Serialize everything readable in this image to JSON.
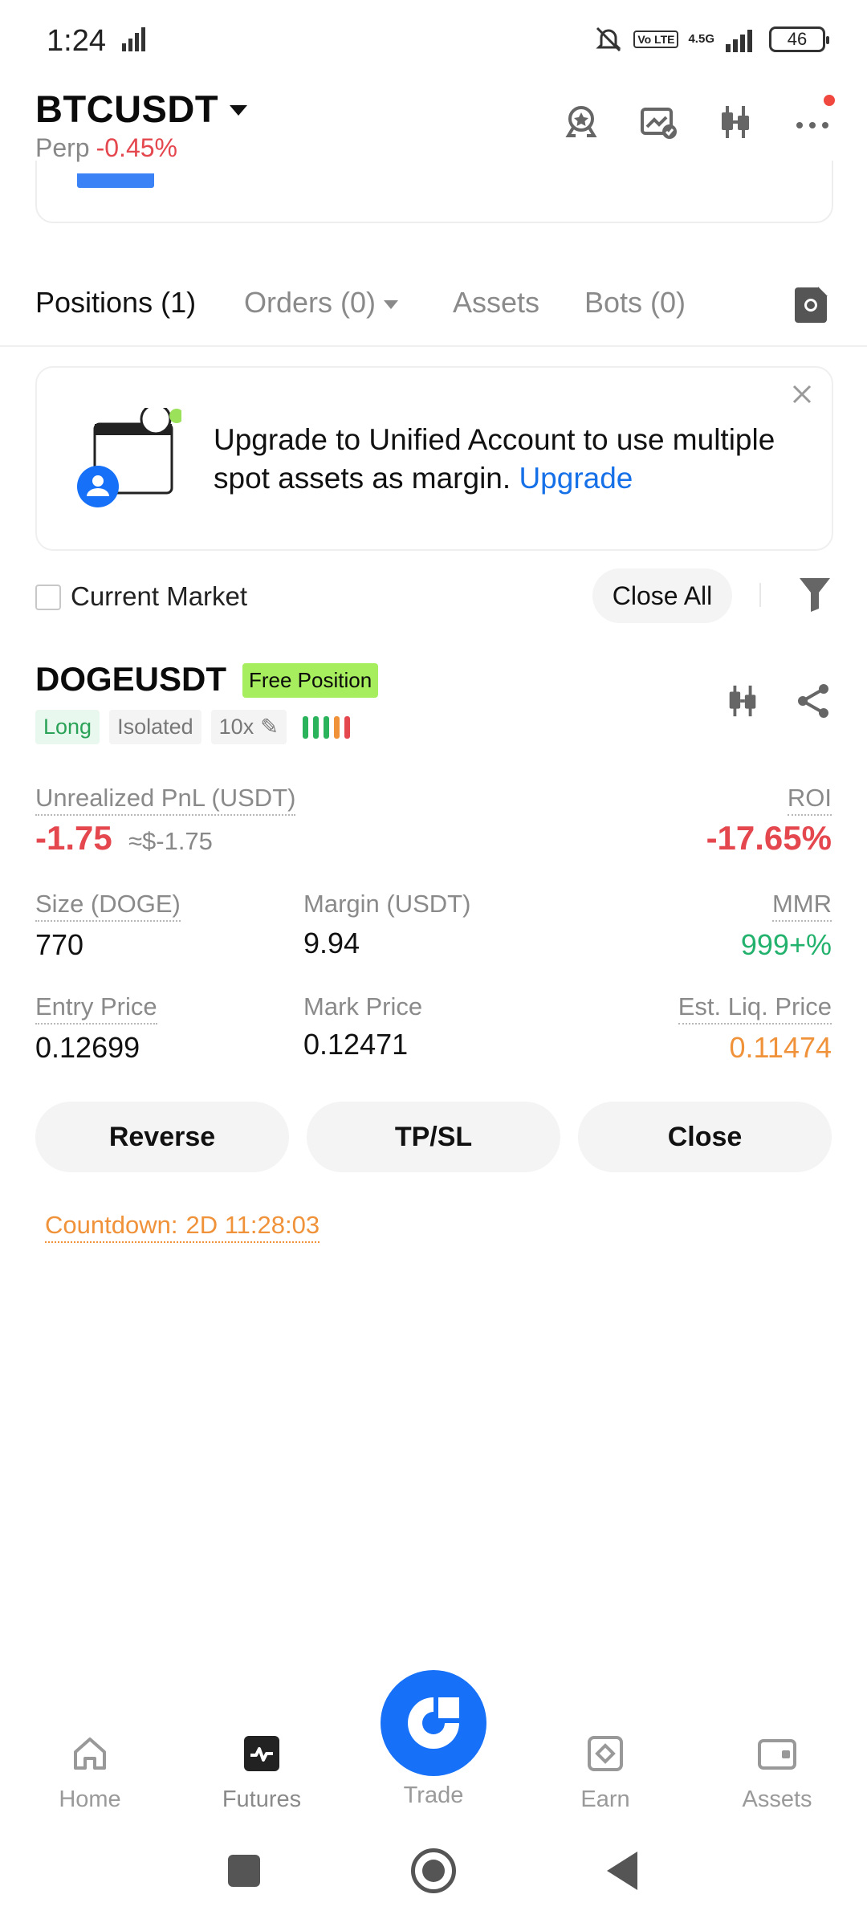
{
  "status_bar": {
    "time": "1:24",
    "network_type": "4.5G",
    "volte_label": "Vo LTE",
    "battery": "46"
  },
  "header": {
    "symbol": "BTCUSDT",
    "contract_type": "Perp",
    "change": "-0.45%",
    "icons": [
      "badge-icon",
      "chart-check-icon",
      "candlestick-icon",
      "more-icon"
    ]
  },
  "tabs": [
    {
      "label": "Positions (1)",
      "active": true
    },
    {
      "label": "Orders (0)",
      "active": false
    },
    {
      "label": "Assets",
      "active": false
    },
    {
      "label": "Bots (0)",
      "active": false
    }
  ],
  "banner": {
    "text": "Upgrade to Unified Account to use multiple spot assets as margin.",
    "link": "Upgrade"
  },
  "filter": {
    "current_market_label": "Current Market",
    "current_market_checked": false,
    "close_all_label": "Close All"
  },
  "position": {
    "symbol": "DOGEUSDT",
    "badge": "Free Position",
    "side": "Long",
    "margin_mode": "Isolated",
    "leverage": "10x",
    "risk_bars": [
      "#2bb35b",
      "#2bb35b",
      "#2bb35b",
      "#f0923a",
      "#e4474e"
    ],
    "unrealized_pnl_label": "Unrealized PnL (USDT)",
    "unrealized_pnl": "-1.75",
    "unrealized_pnl_usd": "≈$-1.75",
    "roi_label": "ROI",
    "roi": "-17.65%",
    "size_label": "Size (DOGE)",
    "size": "770",
    "margin_label": "Margin (USDT)",
    "margin": "9.94",
    "mmr_label": "MMR",
    "mmr": "999+%",
    "entry_price_label": "Entry Price",
    "entry_price": "0.12699",
    "mark_price_label": "Mark Price",
    "mark_price": "0.12471",
    "liq_price_label": "Est. Liq. Price",
    "liq_price": "0.11474",
    "buttons": {
      "reverse": "Reverse",
      "tpsl": "TP/SL",
      "close": "Close"
    },
    "countdown_label": "Countdown:",
    "countdown_value": "2D 11:28:03"
  },
  "bottom_nav": [
    {
      "label": "Home",
      "icon": "home-icon"
    },
    {
      "label": "Futures",
      "icon": "futures-icon"
    },
    {
      "label": "Trade",
      "icon": "trade-icon"
    },
    {
      "label": "Earn",
      "icon": "earn-icon"
    },
    {
      "label": "Assets",
      "icon": "wallet-icon"
    }
  ],
  "colors": {
    "negative": "#e4474e",
    "positive": "#23b26d",
    "warning": "#f0923a",
    "accent": "#1670f8",
    "badge_green": "#a6ee5d"
  }
}
